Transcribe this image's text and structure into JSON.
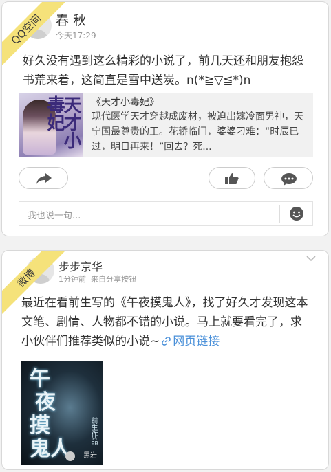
{
  "card1": {
    "badge": "QQ空间",
    "user": {
      "name": "春 秋",
      "time": "今天17:29"
    },
    "text": "好久没有遇到这么精彩的小说了，前几天还和朋友抱怨书荒来着，这简直是雪中送炭。n(*≧▽≦*)n",
    "share": {
      "cover_title": "天才小毒妃",
      "title": "《天才小毒妃》",
      "description": "现代医学天才穿越成废材，被迫出嫁冷面男神，天宁国最尊贵的王。花轿临门，婆婆刁难：“时辰已过，明日再来！”回去？死..."
    },
    "icons": {
      "share": "share-arrow-icon",
      "like": "thumbs-up-icon",
      "comment": "comment-bubble-icon",
      "emoji": "smiley-icon"
    },
    "comment_placeholder": "我也说一句..."
  },
  "card2": {
    "badge": "微博",
    "user": {
      "name": "步步京华",
      "time": "1分钟前",
      "source": "来自分享按钮"
    },
    "text_main": "最近在看前生写的《午夜摸鬼人》，找了好久才发现这本文笔、剧情、人物都不错的小说。马上就要看完了，求小伙伴们推荐类似的小说~",
    "link_label": "网页链接",
    "image": {
      "title_lines": [
        "午",
        "夜",
        "摸",
        "鬼人"
      ],
      "author": "前生作品",
      "logo": "黑岩"
    }
  },
  "colors": {
    "badge": "#f5e27a",
    "link": "#4a90d9"
  }
}
